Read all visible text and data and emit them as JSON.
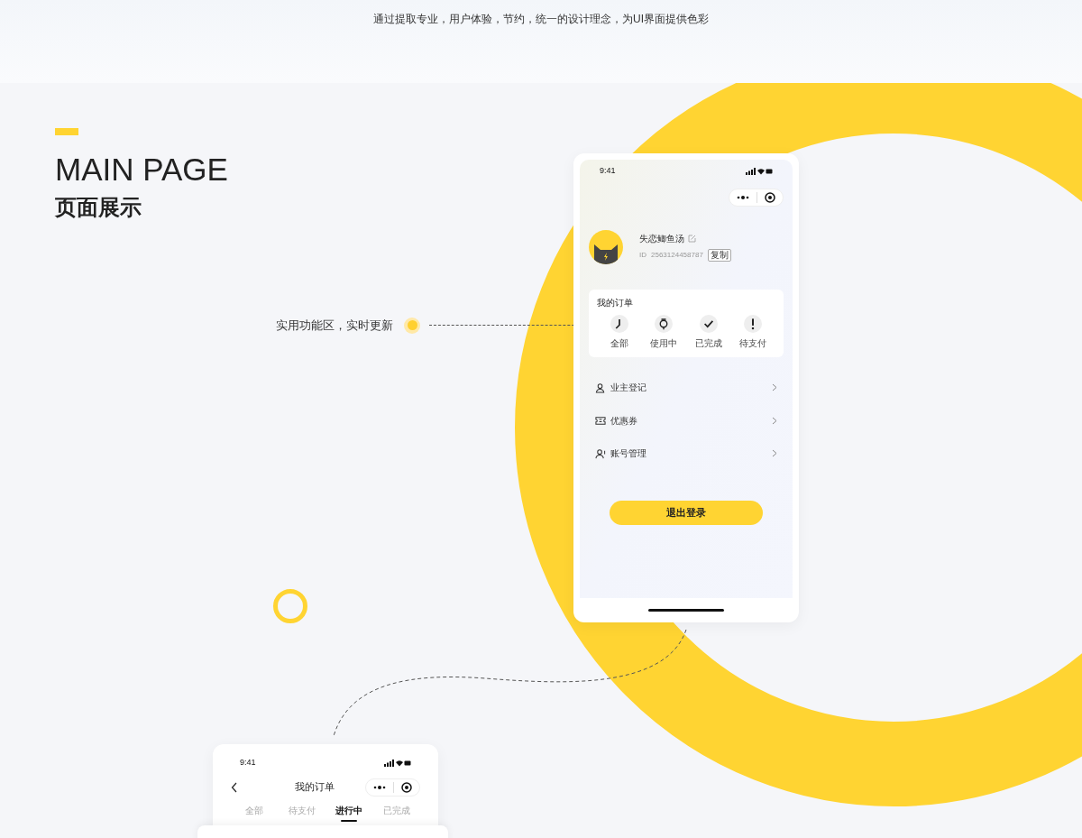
{
  "header": {
    "tagline": "通过提取专业，用户体验，节约，统一的设计理念，为UI界面提供色彩"
  },
  "section": {
    "title": "MAIN PAGE",
    "subtitle": "页面展示"
  },
  "callout": {
    "text": "实用功能区，实时更新"
  },
  "profile_phone": {
    "status_time": "9:41",
    "user_name": "失恋鲫鱼汤",
    "id_label": "ID",
    "id_value": "2563124458787",
    "copy_button": "复制",
    "orders": {
      "title": "我的订单",
      "items": [
        {
          "kind": "all",
          "label": "全部"
        },
        {
          "kind": "in_use",
          "label": "使用中"
        },
        {
          "kind": "done",
          "label": "已完成"
        },
        {
          "kind": "pending",
          "label": "待支付"
        }
      ]
    },
    "menu": [
      {
        "kind": "owner",
        "label": "业主登记"
      },
      {
        "kind": "coupon",
        "label": "优惠券"
      },
      {
        "kind": "account",
        "label": "账号管理"
      }
    ],
    "logout_button": "退出登录"
  },
  "orders_phone": {
    "status_time": "9:41",
    "title": "我的订单",
    "tabs": [
      {
        "label": "全部",
        "selected": false
      },
      {
        "label": "待支付",
        "selected": false
      },
      {
        "label": "进行中",
        "selected": true
      },
      {
        "label": "已完成",
        "selected": false
      }
    ]
  }
}
